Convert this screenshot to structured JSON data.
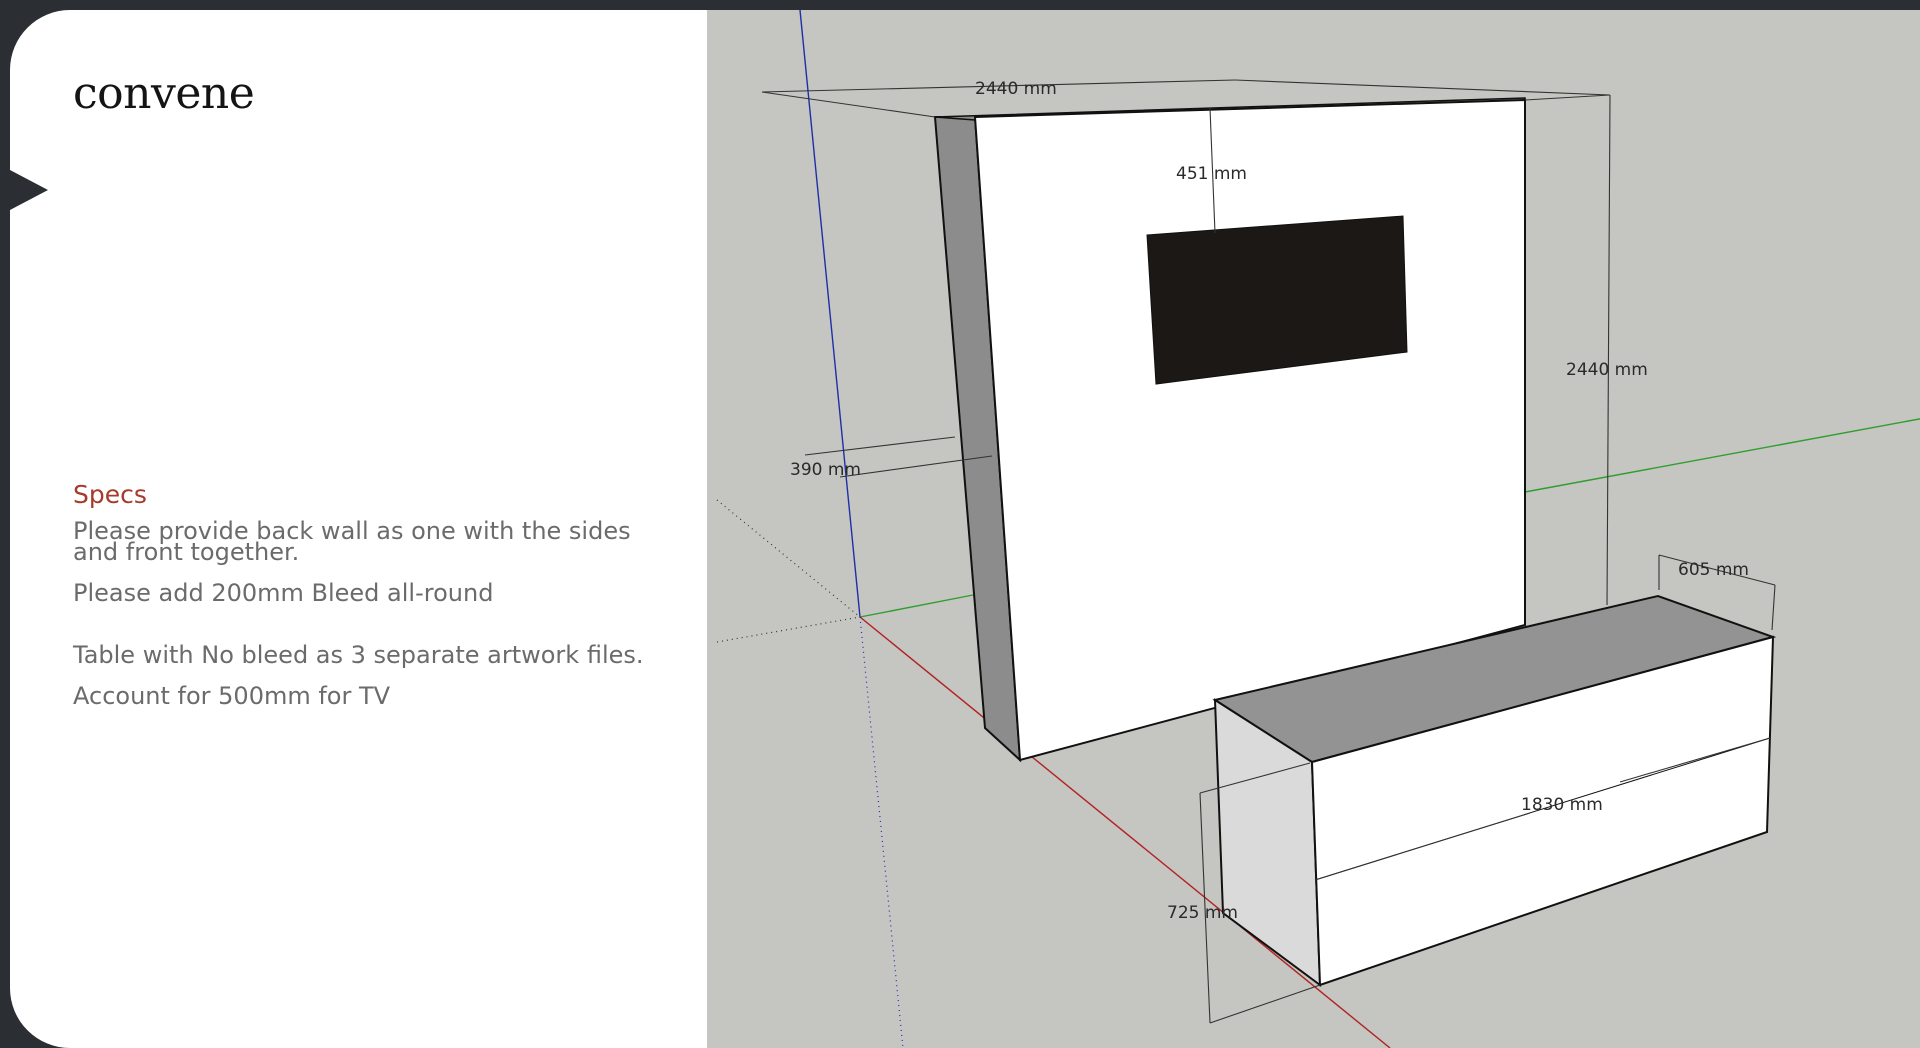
{
  "brand": {
    "logo_text": "convene"
  },
  "specs": {
    "title": "Specs",
    "items": [
      "Please provide back wall as one with the sides and front together.",
      "Please add 200mm Bleed all-round",
      "Table with No bleed as 3 separate artwork files.",
      "Account for 500mm for TV"
    ]
  },
  "model": {
    "dimensions": {
      "wall_width": "2440 mm",
      "wall_height": "2440 mm",
      "wall_depth": "390 mm",
      "tv_offset_top": "451 mm",
      "table_depth": "605 mm",
      "table_length": "1830 mm",
      "table_height": "725 mm"
    }
  },
  "colors": {
    "accent": "#a63a2c",
    "viewport_bg": "#c5c5c2",
    "axis_red": "#b22222",
    "axis_green": "#2f9e2f",
    "axis_blue": "#1f2fa8",
    "tv_screen": "#1b1816"
  }
}
